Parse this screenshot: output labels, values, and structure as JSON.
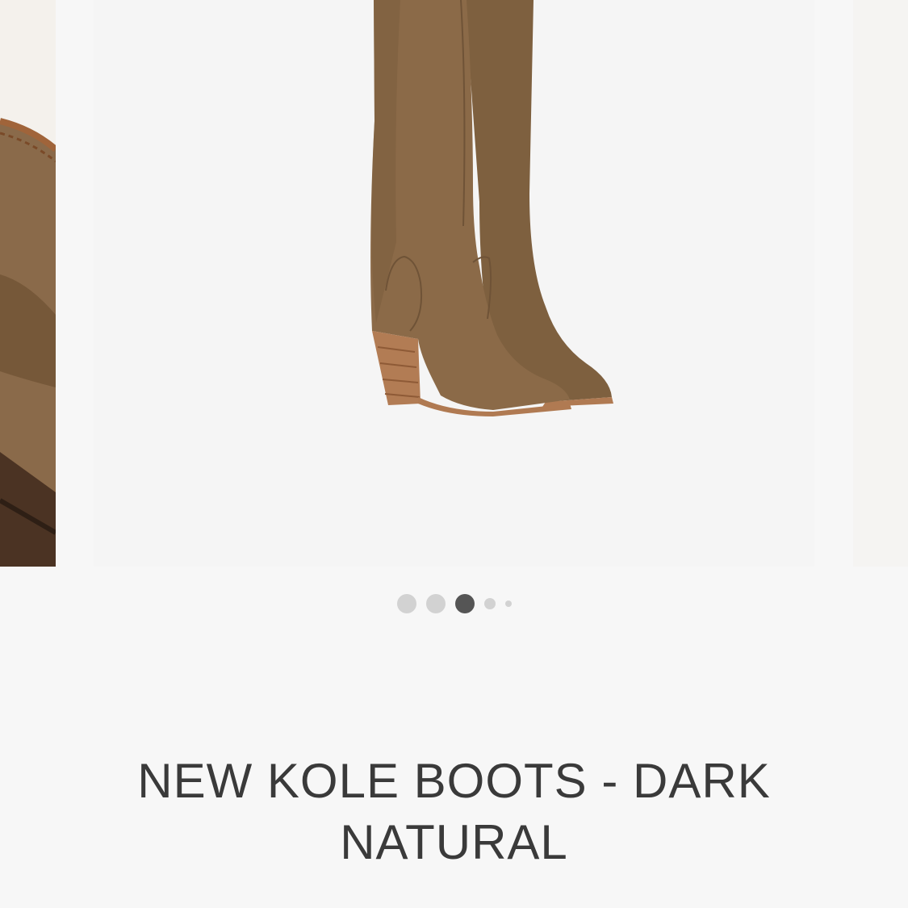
{
  "product": {
    "title": "NEW KOLE BOOTS - DARK NATURAL"
  },
  "carousel": {
    "slide_count": 5,
    "active_index": 2,
    "colors": {
      "suede": "#8b6a48",
      "suede_shadow": "#6f5337",
      "sole": "#b07a52",
      "dot_inactive": "#d2d2d2",
      "dot_active": "#555555"
    }
  }
}
